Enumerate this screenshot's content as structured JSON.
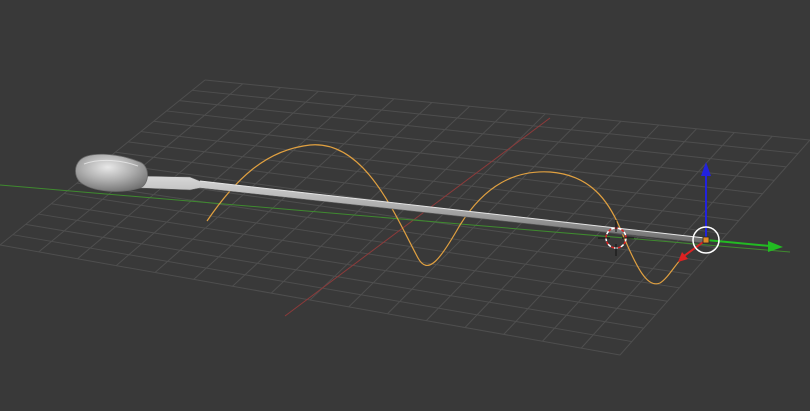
{
  "viewport": {
    "background": "#393939",
    "grid_color": "#4e4e4e",
    "x_axis_color": "#9a3a3a",
    "y_axis_color": "#3f8a2f",
    "curve_color": "#e0a040",
    "object_color": "#9a9a9a",
    "gizmo_blue": "#2222dd",
    "gizmo_green": "#22bb22",
    "gizmo_red": "#dd2222"
  },
  "objects": {
    "curve_name": "",
    "mesh_name": ""
  },
  "icons": [
    "3d-cursor-icon",
    "object-origin-icon",
    "transform-gizmo-icon"
  ]
}
